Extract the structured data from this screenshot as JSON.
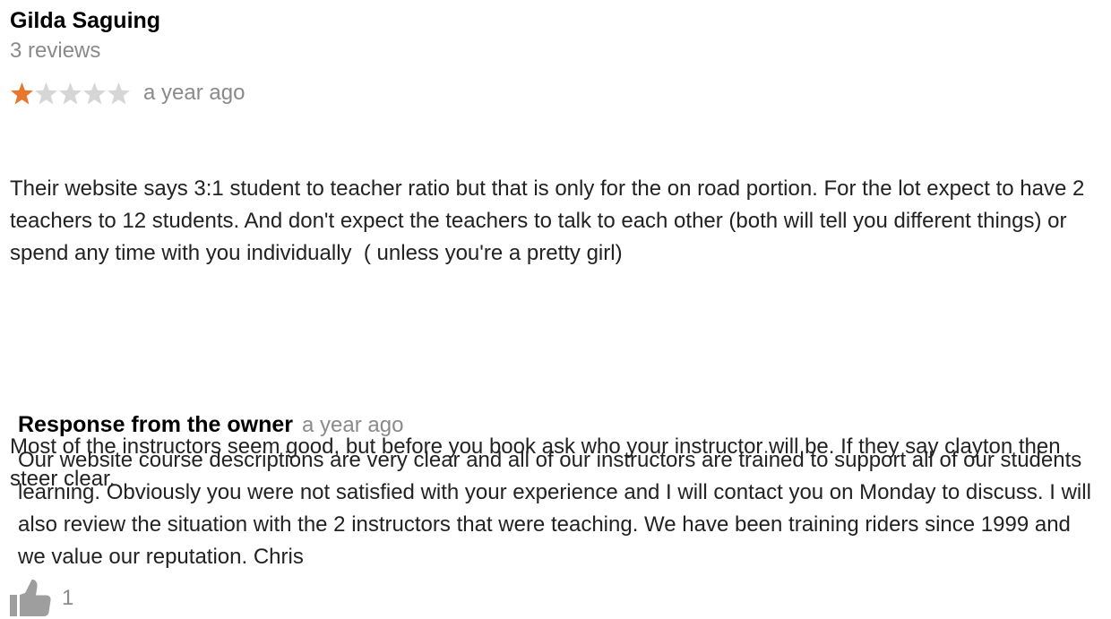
{
  "review": {
    "reviewer_name": "Gilda Saguing",
    "review_count": "3 reviews",
    "rating": 1,
    "rating_max": 5,
    "time": "a year ago",
    "paragraphs": [
      "Their website says 3:1 student to teacher ratio but that is only for the on road portion. For the lot expect to have 2 teachers to 12 students. And don't expect the teachers to talk to each other (both will tell you different things) or spend any time with you individually  ( unless you're a pretty girl)",
      "Most of the instructors seem good, but before you book ask who your instructor will be. If they say clayton then steer clear."
    ],
    "likes": "1"
  },
  "owner_response": {
    "title": "Response from the owner",
    "time": "a year ago",
    "text": "Our website course descriptions are very clear and all of our instructors are trained to support all of our students learning. Obviously you were not satisfied with your experience and I will contact you on Monday to discuss. I will also review the situation with the 2 instructors that were teaching. We have been training riders since 1999 and we value our reputation. Chris"
  },
  "colors": {
    "star_filled": "#e8762c",
    "star_empty": "#d6d6d6",
    "muted_text": "#8a8a8a",
    "thumb_icon": "#9e9e9e"
  },
  "icons": {
    "star": "star-icon",
    "thumbs_up": "thumbs-up-icon"
  }
}
